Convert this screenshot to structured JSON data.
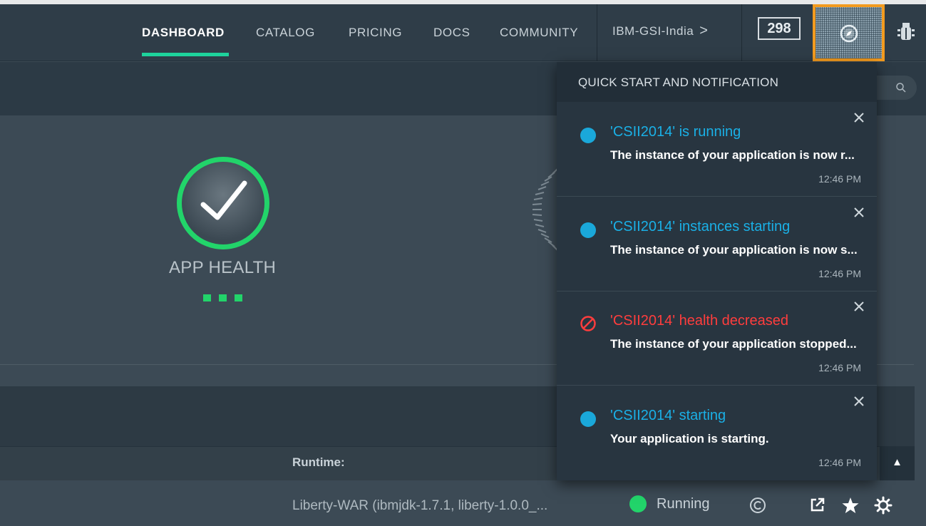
{
  "nav": {
    "links": [
      "DASHBOARD",
      "CATALOG",
      "PRICING",
      "DOCS",
      "COMMUNITY"
    ],
    "active": "DASHBOARD",
    "org": "IBM-GSI-India",
    "org_chevron": ">",
    "count": "298"
  },
  "dashboard": {
    "app_health_label": "APP HEALTH",
    "health_status_color": "#22d46a"
  },
  "app": {
    "runtime_label": "Runtime:",
    "runtime_value": "Liberty-WAR (ibmjdk-1.7.1, liberty-1.0.0_...",
    "status": "Running",
    "status_color": "#22d46a"
  },
  "panel": {
    "title": "QUICK START AND NOTIFICATION",
    "notifications": [
      {
        "type": "info",
        "title": "'CSII2014' is running",
        "body": "The instance of your application is now r...",
        "time": "12:46 PM"
      },
      {
        "type": "info",
        "title": "'CSII2014' instances starting",
        "body": "The instance of your application is now s...",
        "time": "12:46 PM"
      },
      {
        "type": "error",
        "title": "'CSII2014' health decreased",
        "body": "The instance of your application stopped...",
        "time": "12:46 PM"
      },
      {
        "type": "info",
        "title": "'CSII2014' starting",
        "body": "Your application is starting.",
        "time": "12:46 PM"
      }
    ]
  },
  "colors": {
    "accent": "#1ed39c",
    "info": "#1ab0e6",
    "error": "#ff3d3d",
    "highlight": "#f39b1f"
  },
  "icons": [
    "compass-icon",
    "bug-icon",
    "search-icon",
    "checkmark-icon",
    "close-icon",
    "no-entry-icon",
    "copyright-icon",
    "external-link-icon",
    "star-icon",
    "gear-icon",
    "chevron-up-icon"
  ]
}
